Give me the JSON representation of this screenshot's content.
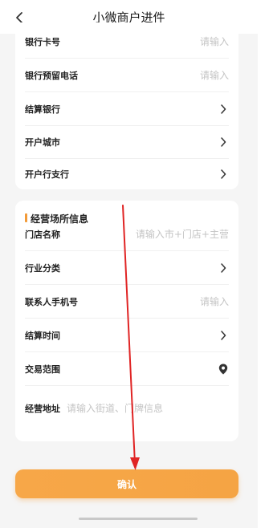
{
  "header": {
    "title": "小微商户进件"
  },
  "bank_section": {
    "rows": [
      {
        "label": "银行卡号",
        "placeholder": "请输入"
      },
      {
        "label": "银行预留电话",
        "placeholder": "请输入"
      },
      {
        "label": "结算银行"
      },
      {
        "label": "开户城市"
      },
      {
        "label": "开户行支行"
      }
    ]
  },
  "shop_section": {
    "title": "经营场所信息",
    "rows": [
      {
        "label": "门店名称",
        "placeholder": "请输入市+门店+主营"
      },
      {
        "label": "行业分类"
      },
      {
        "label": "联系人手机号",
        "placeholder": "请输入"
      },
      {
        "label": "结算时间"
      },
      {
        "label": "交易范围"
      },
      {
        "label": "经营地址",
        "placeholder": "请输入街道、门牌信息"
      }
    ]
  },
  "confirm_label": "确认",
  "colors": {
    "accent": "#f5a444",
    "annotation": "#e02424"
  },
  "icons": {
    "back": "chevron-left-icon",
    "chevron": "chevron-right-icon",
    "location": "location-pin-icon"
  }
}
